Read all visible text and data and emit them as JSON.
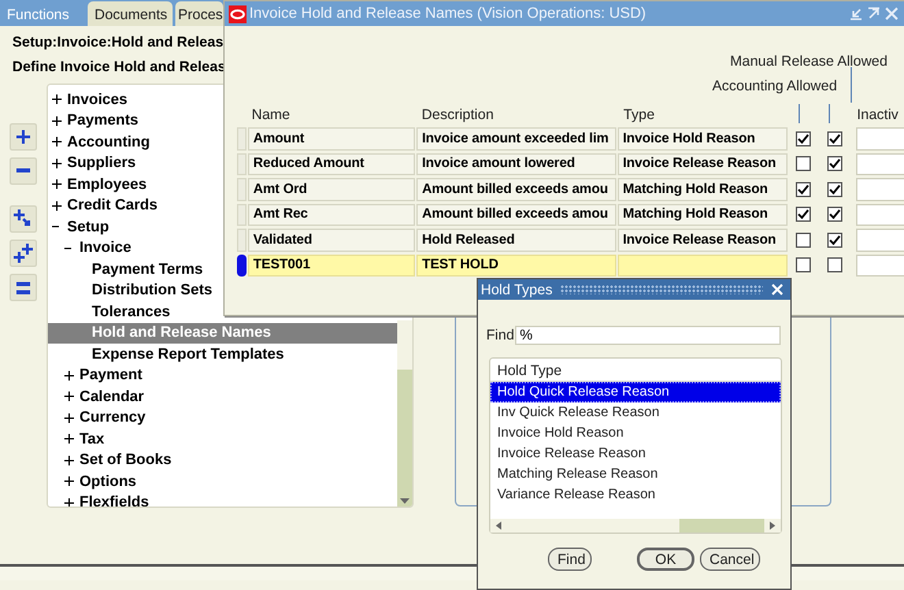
{
  "navigator": {
    "tabs": [
      {
        "label": "Functions",
        "selected": true
      },
      {
        "label": "Documents",
        "selected": false
      },
      {
        "label": "Proces",
        "selected": false
      }
    ],
    "path": "Setup:Invoice:Hold and Releas",
    "heading": "Define Invoice Hold and Releas",
    "tree": [
      {
        "label": "Invoices",
        "expanded": false,
        "selected": false
      },
      {
        "label": "Payments",
        "expanded": false,
        "selected": false
      },
      {
        "label": "Accounting",
        "expanded": false,
        "selected": false
      },
      {
        "label": "Suppliers",
        "expanded": false,
        "selected": false
      },
      {
        "label": "Employees",
        "expanded": false,
        "selected": false
      },
      {
        "label": "Credit Cards",
        "expanded": false,
        "selected": false
      },
      {
        "label": "Setup",
        "expanded": true,
        "selected": false,
        "children": [
          {
            "label": "Invoice",
            "expanded": true,
            "selected": false,
            "children": [
              {
                "label": "Payment Terms",
                "selected": false
              },
              {
                "label": "Distribution Sets",
                "selected": false
              },
              {
                "label": "Tolerances",
                "selected": false
              },
              {
                "label": "Hold and Release Names",
                "selected": true
              },
              {
                "label": "Expense Report Templates",
                "selected": false
              }
            ]
          },
          {
            "label": "Payment",
            "expanded": false,
            "selected": false
          },
          {
            "label": "Calendar",
            "expanded": false,
            "selected": false
          },
          {
            "label": "Currency",
            "expanded": false,
            "selected": false
          },
          {
            "label": "Tax",
            "expanded": false,
            "selected": false
          },
          {
            "label": "Set of Books",
            "expanded": false,
            "selected": false
          },
          {
            "label": "Options",
            "expanded": false,
            "selected": false
          },
          {
            "label": "Flexfields",
            "expanded": false,
            "selected": false
          }
        ]
      }
    ]
  },
  "hold_window": {
    "title": "Invoice Hold and Release Names (Vision Operations: USD)",
    "columns": {
      "name": "Name",
      "description": "Description",
      "type": "Type",
      "accounting": "Accounting Allowed",
      "manual": "Manual Release Allowed",
      "inactive": "Inactiv"
    },
    "rows": [
      {
        "name": "Amount",
        "description": "Invoice amount exceeded lim",
        "type": "Invoice Hold Reason",
        "accounting_allowed": true,
        "manual_release_allowed": true,
        "selected": false
      },
      {
        "name": "Reduced Amount",
        "description": "Invoice amount lowered",
        "type": "Invoice Release Reason",
        "accounting_allowed": false,
        "manual_release_allowed": true,
        "selected": false
      },
      {
        "name": "Amt Ord",
        "description": "Amount billed exceeds amou",
        "type": "Matching Hold Reason",
        "accounting_allowed": true,
        "manual_release_allowed": true,
        "selected": false
      },
      {
        "name": "Amt Rec",
        "description": "Amount billed exceeds amou",
        "type": "Matching Hold Reason",
        "accounting_allowed": true,
        "manual_release_allowed": true,
        "selected": false
      },
      {
        "name": "Validated",
        "description": "Hold Released",
        "type": "Invoice Release Reason",
        "accounting_allowed": false,
        "manual_release_allowed": true,
        "selected": false
      },
      {
        "name": "TEST001",
        "description": "TEST HOLD",
        "accounting_allowed": false,
        "manual_release_allowed": false,
        "selected": true
      }
    ]
  },
  "dialog": {
    "title": "Hold Types",
    "find_label": "Find",
    "find_value": "%",
    "list_header": "Hold Type",
    "items": [
      {
        "label": "Hold Quick Release Reason",
        "selected": true
      },
      {
        "label": "Inv Quick Release Reason",
        "selected": false
      },
      {
        "label": "Invoice Hold Reason",
        "selected": false
      },
      {
        "label": "Invoice Release Reason",
        "selected": false
      },
      {
        "label": "Matching Release Reason",
        "selected": false
      },
      {
        "label": "Variance Release Reason",
        "selected": false
      }
    ],
    "buttons": [
      "Find",
      "OK",
      "Cancel"
    ]
  }
}
